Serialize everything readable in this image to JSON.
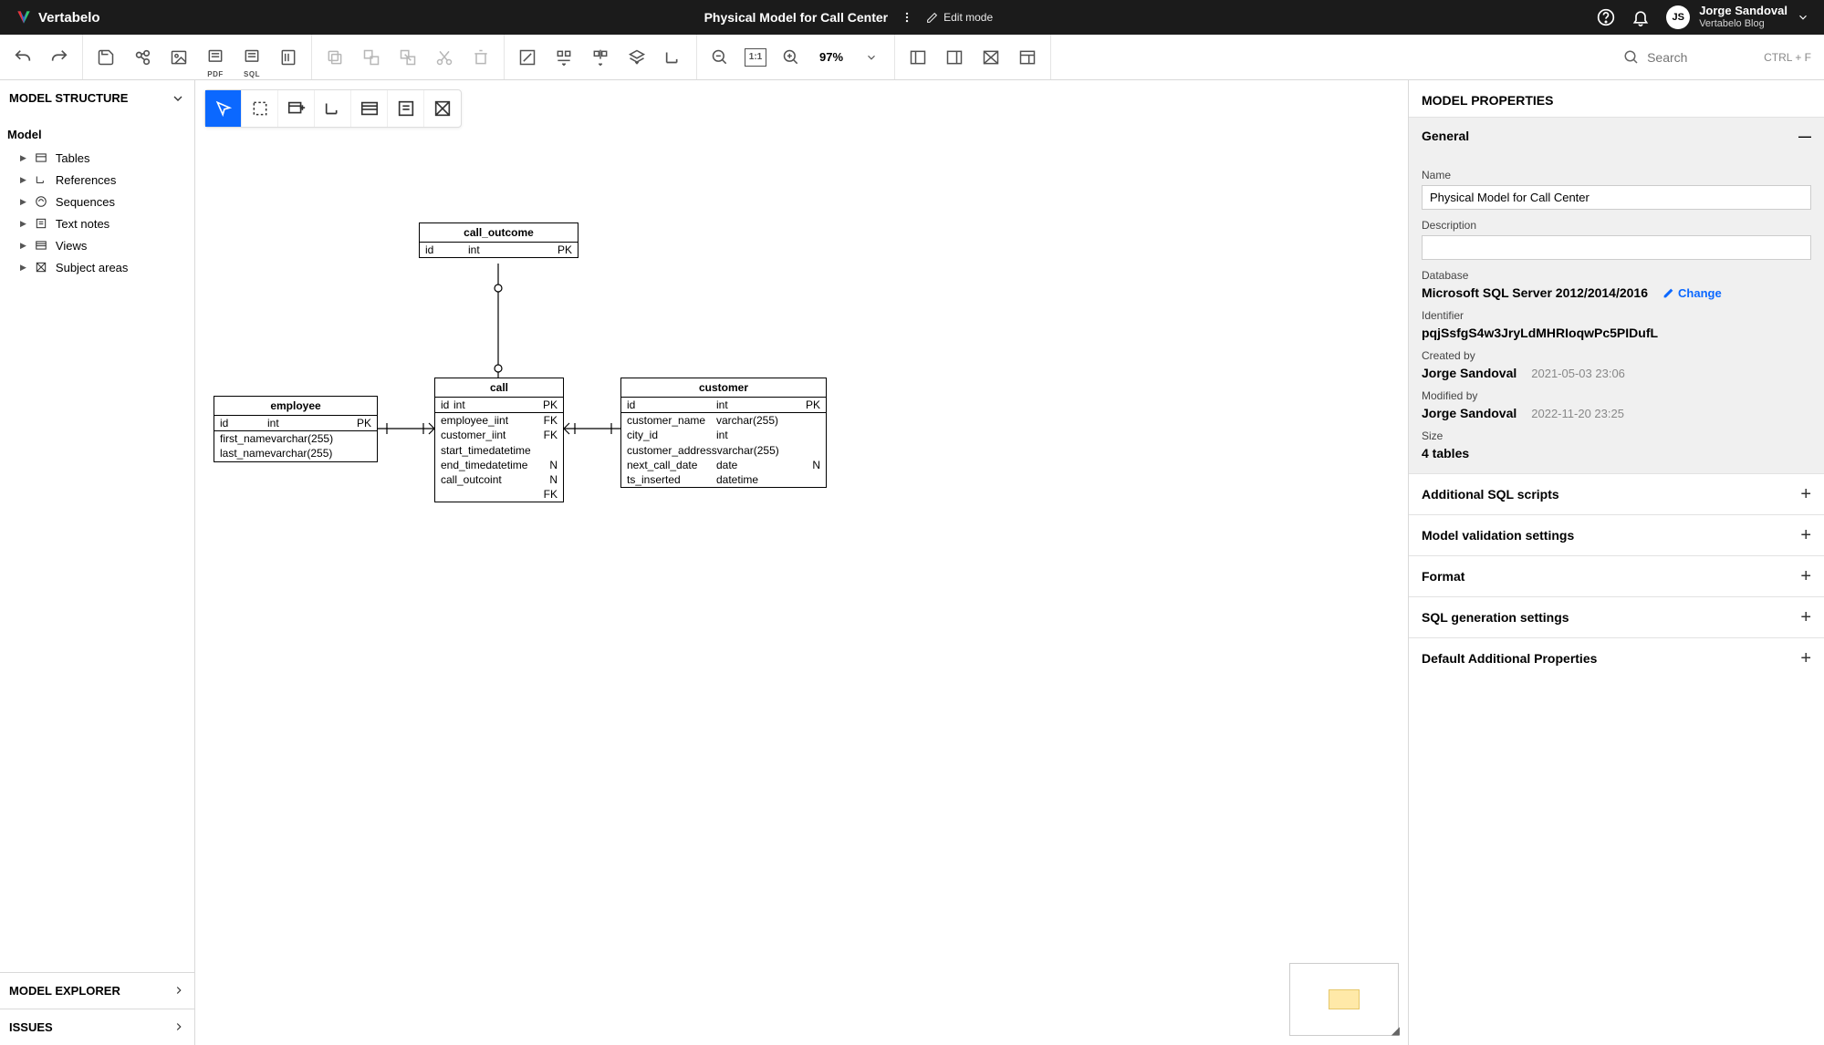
{
  "header": {
    "brand": "Vertabelo",
    "title": "Physical Model for Call Center",
    "editMode": "Edit mode",
    "user": {
      "initials": "JS",
      "name": "Jorge Sandoval",
      "sub": "Vertabelo Blog"
    }
  },
  "toolbar": {
    "zoom": "97%",
    "searchPlaceholder": "Search",
    "shortcut": "CTRL + F",
    "zoomRatio": "1:1"
  },
  "leftPanel": {
    "structure": "MODEL STRUCTURE",
    "modelHeading": "Model",
    "items": [
      {
        "label": "Tables"
      },
      {
        "label": "References"
      },
      {
        "label": "Sequences"
      },
      {
        "label": "Text notes"
      },
      {
        "label": "Views"
      },
      {
        "label": "Subject areas"
      }
    ],
    "explorer": "MODEL EXPLORER",
    "issues": "ISSUES"
  },
  "tables": {
    "call_outcome": {
      "name": "call_outcome",
      "rows": [
        {
          "n": "id",
          "t": "int",
          "k": "PK"
        }
      ]
    },
    "employee": {
      "name": "employee",
      "rows": [
        {
          "n": "id",
          "t": "int",
          "k": "PK"
        },
        {
          "n": "first_name",
          "t": "varchar(255)",
          "k": ""
        },
        {
          "n": "last_name",
          "t": "varchar(255)",
          "k": ""
        }
      ]
    },
    "call": {
      "name": "call",
      "rows": [
        {
          "n": "id",
          "t": "int",
          "k": "PK"
        },
        {
          "n": "employee_i",
          "t": "int",
          "k": "FK"
        },
        {
          "n": "customer_i",
          "t": "int",
          "k": "FK"
        },
        {
          "n": "start_time",
          "t": "datetime",
          "k": ""
        },
        {
          "n": "end_time",
          "t": "datetime",
          "k": "N"
        },
        {
          "n": "call_outco",
          "t": "int",
          "k": "N FK"
        }
      ]
    },
    "customer": {
      "name": "customer",
      "rows": [
        {
          "n": "id",
          "t": "int",
          "k": "PK"
        },
        {
          "n": "customer_name",
          "t": "varchar(255)",
          "k": ""
        },
        {
          "n": "city_id",
          "t": "int",
          "k": ""
        },
        {
          "n": "customer_address",
          "t": "varchar(255)",
          "k": ""
        },
        {
          "n": "next_call_date",
          "t": "date",
          "k": "N"
        },
        {
          "n": "ts_inserted",
          "t": "datetime",
          "k": ""
        }
      ]
    }
  },
  "props": {
    "title": "MODEL PROPERTIES",
    "general": "General",
    "nameLabel": "Name",
    "nameValue": "Physical Model for Call Center",
    "descLabel": "Description",
    "descValue": "",
    "dbLabel": "Database",
    "dbValue": "Microsoft SQL Server 2012/2014/2016",
    "changeLabel": "Change",
    "identLabel": "Identifier",
    "identValue": "pqjSsfgS4w3JryLdMHRIoqwPc5PIDufL",
    "createdByLabel": "Created by",
    "createdByName": "Jorge Sandoval",
    "createdAt": "2021-05-03 23:06",
    "modifiedByLabel": "Modified by",
    "modifiedByName": "Jorge Sandoval",
    "modifiedAt": "2022-11-20 23:25",
    "sizeLabel": "Size",
    "sizeValue": "4 tables",
    "sections": [
      "Additional SQL scripts",
      "Model validation settings",
      "Format",
      "SQL generation settings",
      "Default Additional Properties"
    ]
  }
}
